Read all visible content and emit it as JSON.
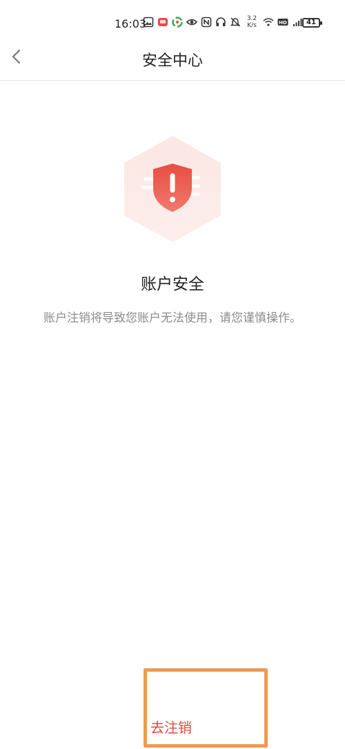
{
  "status_bar": {
    "time": "16:03",
    "net_speed_value": "3.2",
    "net_speed_unit": "K/s",
    "battery": "41",
    "icons": [
      "gallery-icon",
      "app-badge-icon",
      "sync-icon",
      "eye-icon",
      "nfc-icon",
      "headphone-icon",
      "mute-icon",
      "wifi-icon",
      "hd-icon",
      "signal-icon"
    ]
  },
  "header": {
    "title": "安全中心",
    "back_icon": "chevron-left-icon"
  },
  "main": {
    "illustration_icon": "shield-warning-icon",
    "section_title": "账户安全",
    "warning_text": "账户注销将导致您账户无法使用，请您谨慎操作。"
  },
  "footer": {
    "cancel_label": "去注销"
  },
  "colors": {
    "accent_red": "#e0493b",
    "highlight_orange": "#ee9a52",
    "muted_text": "#8c8c8c"
  }
}
